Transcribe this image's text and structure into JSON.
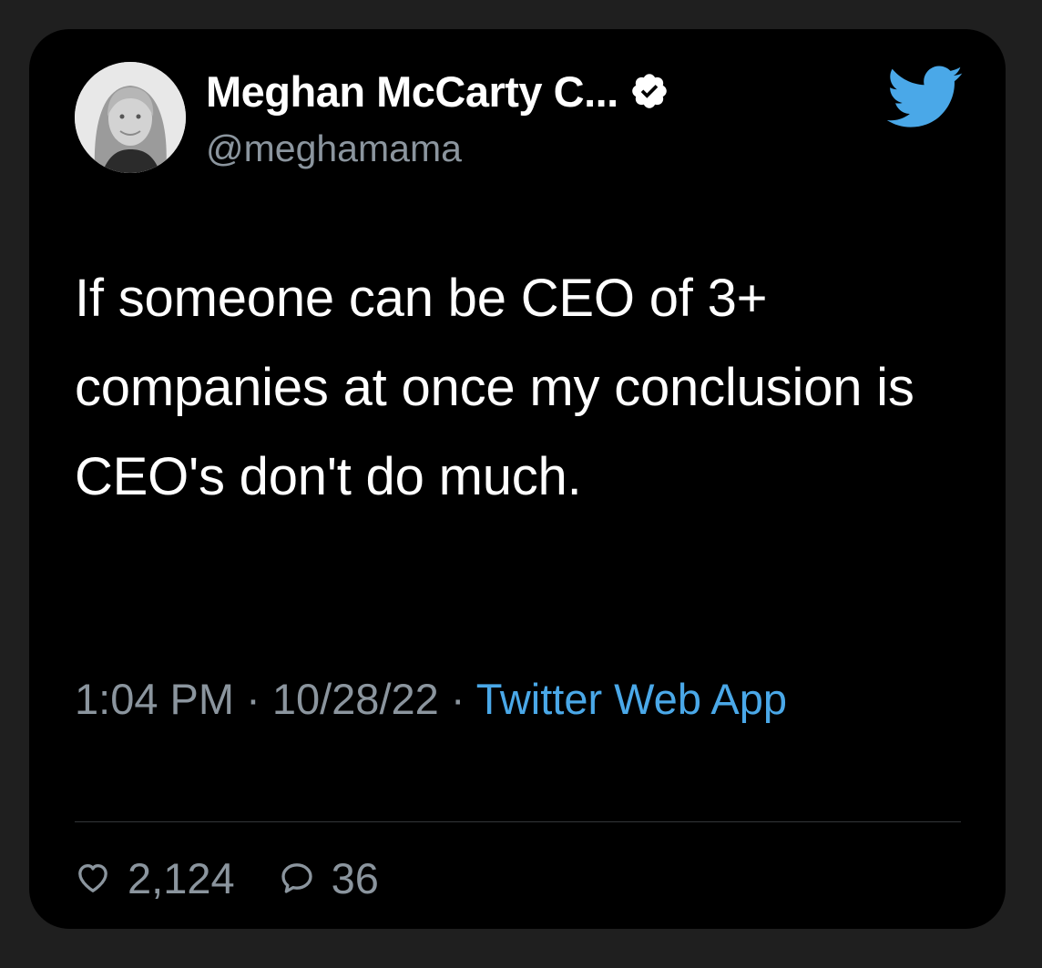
{
  "author": {
    "display_name": "Meghan McCarty C...",
    "handle": "@meghamama",
    "verified": true,
    "avatar_icon": "profile-photo",
    "verified_icon": "verified-badge-icon"
  },
  "brand": {
    "icon": "twitter-bird-icon",
    "color": "#4aa8e8"
  },
  "tweet": {
    "text": "If someone can be CEO of 3+ companies at once my conclusion is CEO's don't do much.",
    "time": "1:04 PM",
    "separator1": " · ",
    "date": "10/28/22",
    "separator2": " · ",
    "source": "Twitter Web App"
  },
  "stats": {
    "likes": "2,124",
    "likes_icon": "heart-icon",
    "replies": "36",
    "replies_icon": "reply-bubble-icon"
  },
  "colors": {
    "page_background": "#1f1f1f",
    "card_background": "#000000",
    "primary_text": "#ffffff",
    "secondary_text": "#8b959e",
    "link": "#4aa8e8"
  }
}
